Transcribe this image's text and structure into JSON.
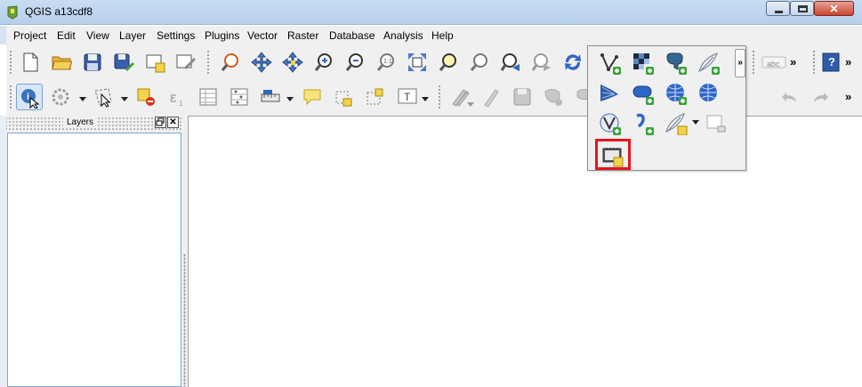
{
  "window": {
    "title": "QGIS a13cdf8"
  },
  "menubar": {
    "items": [
      "Project",
      "Edit",
      "View",
      "Layer",
      "Settings",
      "Plugins",
      "Vector",
      "Raster",
      "Database",
      "Analysis",
      "Help"
    ]
  },
  "layers_panel": {
    "title": "Layers"
  },
  "toolbar": {
    "label_tool_text": "abc",
    "more_glyph": "»",
    "help_glyph": "?"
  },
  "colors": {
    "accent_blue": "#2f66c6",
    "add_green": "#3aa23a",
    "highlight_red": "#e8141c",
    "canvas": "#ffffff",
    "chrome": "#f0f0f0"
  },
  "icons": {
    "row1": [
      "new-project-icon",
      "open-project-icon",
      "save-project-icon",
      "save-as-icon",
      "new-print-composer-icon",
      "composer-manager-icon",
      "pan-to-selection-icon",
      "pan-icon",
      "pan-map-icon",
      "zoom-in-icon",
      "zoom-out-icon",
      "zoom-native-icon",
      "zoom-full-icon",
      "zoom-to-layer-icon",
      "zoom-to-selection-icon",
      "zoom-last-icon",
      "zoom-next-icon",
      "refresh-icon"
    ],
    "row2": [
      "identify-icon",
      "select-icon",
      "select-by-polygon-icon",
      "deselect-icon",
      "field-calculator-icon",
      "attribute-table-icon",
      "statistics-icon",
      "measure-icon",
      "map-tips-icon",
      "new-bookmark-icon",
      "show-bookmarks-icon",
      "text-annotation-icon",
      "current-edits-icon",
      "toggle-editing-icon",
      "save-edits-icon",
      "delete-selected-icon",
      "undo-icon",
      "redo-icon"
    ],
    "popup": [
      "add-vector-layer-icon",
      "add-raster-layer-icon",
      "add-postgis-layer-icon",
      "add-spatialite-layer-icon",
      "add-mssql-layer-icon",
      "add-oracle-layer-icon",
      "add-wms-layer-icon",
      "add-wcs-layer-icon",
      "add-wfs-layer-icon",
      "add-delimited-text-icon",
      "new-shapefile-layer-icon",
      "new-spatialite-layer-icon",
      "new-memory-layer-icon",
      "add-virtual-layer-icon"
    ]
  }
}
